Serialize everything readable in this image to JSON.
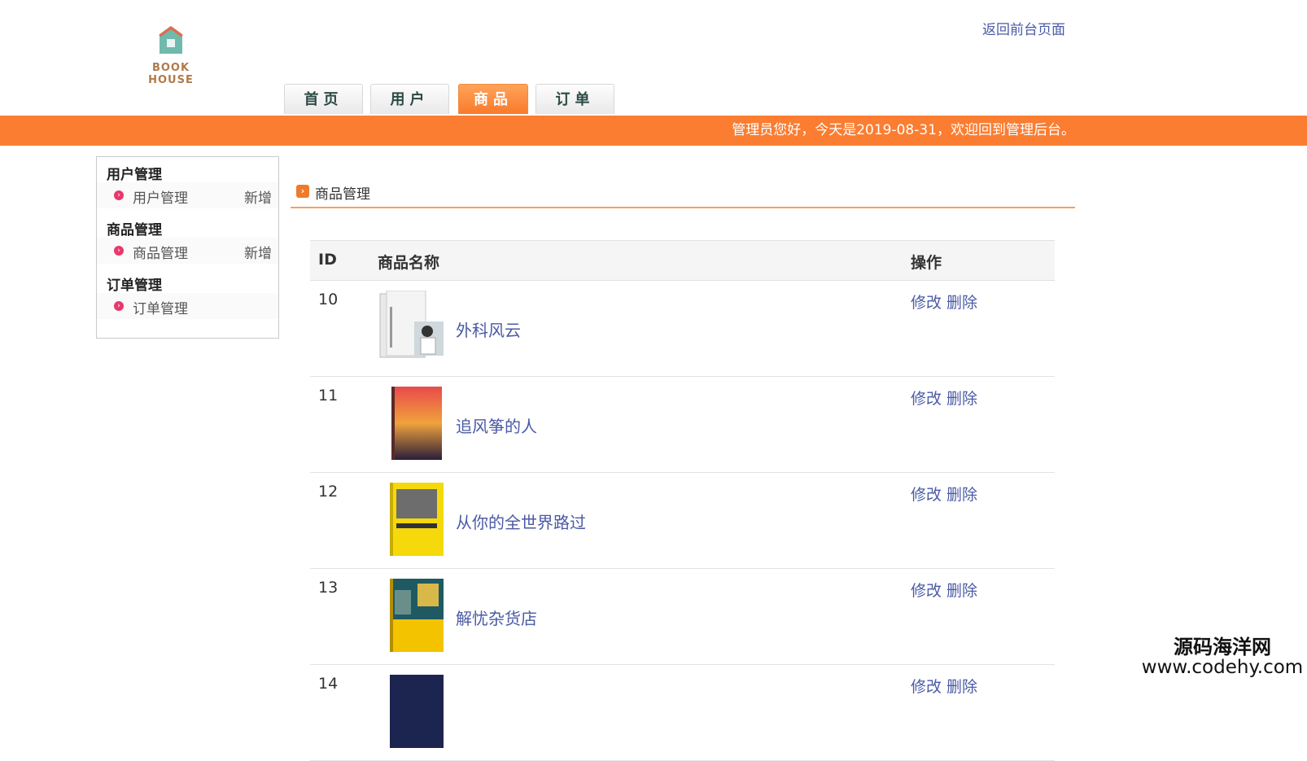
{
  "header": {
    "logo_text": "BOOK HOUSE",
    "back_link": "返回前台页面",
    "nav": [
      "首页",
      "用户",
      "商品",
      "订单"
    ],
    "nav_active_index": 2,
    "welcome": "管理员您好，今天是2019-08-31，欢迎回到管理后台。"
  },
  "sidebar": {
    "groups": [
      {
        "title": "用户管理",
        "item": "用户管理",
        "action": "新增"
      },
      {
        "title": "商品管理",
        "item": "商品管理",
        "action": "新增"
      },
      {
        "title": "订单管理",
        "item": "订单管理",
        "action": ""
      }
    ]
  },
  "main": {
    "section_title": "商品管理",
    "columns": [
      "ID",
      "商品名称",
      "操作"
    ],
    "rows": [
      {
        "id": "10",
        "name": "外科风云",
        "edit": "修改",
        "delete": "删除"
      },
      {
        "id": "11",
        "name": "追风筝的人",
        "edit": "修改",
        "delete": "删除"
      },
      {
        "id": "12",
        "name": "从你的全世界路过",
        "edit": "修改",
        "delete": "删除"
      },
      {
        "id": "13",
        "name": "解忧杂货店",
        "edit": "修改",
        "delete": "删除"
      },
      {
        "id": "14",
        "name": "",
        "edit": "修改",
        "delete": "删除"
      }
    ]
  },
  "watermark": {
    "line1": "源码海洋网",
    "line2": "www.codehy.com"
  },
  "colors": {
    "accent": "#fb7d31",
    "link": "#4a5aa5",
    "bullet": "#e8386e"
  }
}
